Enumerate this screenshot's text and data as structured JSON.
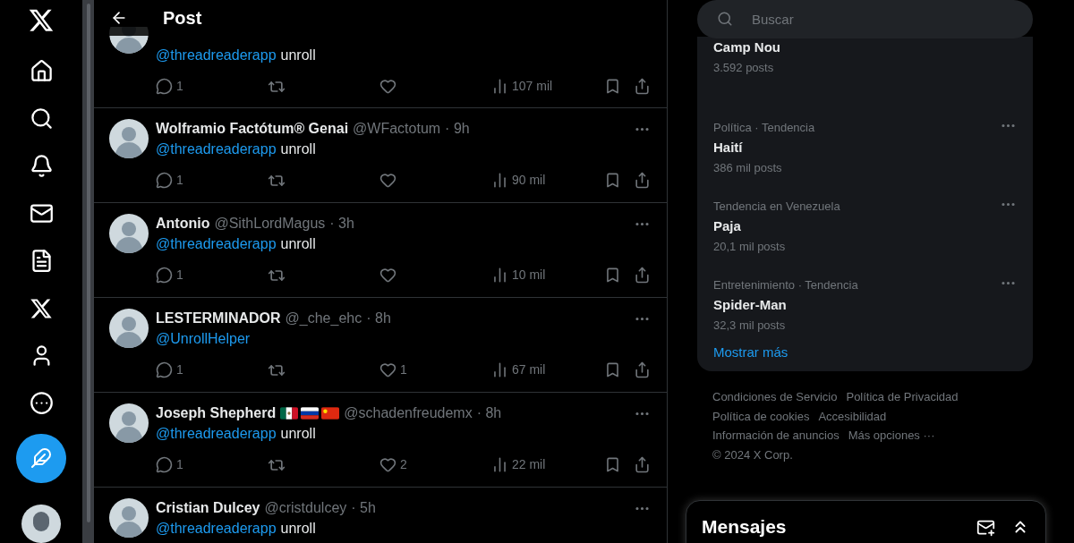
{
  "header": {
    "title": "Post"
  },
  "posts": [
    {
      "mention": "@threadreaderapp",
      "text": "unroll",
      "replies": "1",
      "views": "107 mil"
    },
    {
      "name": "Wolframio Factótum® Genai",
      "handle": "@WFactotum",
      "time": "· 9h",
      "mention": "@threadreaderapp",
      "text": "unroll",
      "replies": "1",
      "views": "90 mil"
    },
    {
      "name": "Antonio",
      "handle": "@SithLordMagus",
      "time": "· 3h",
      "mention": "@threadreaderapp",
      "text": "unroll",
      "replies": "1",
      "views": "10 mil"
    },
    {
      "name": "LESTERMINADOR",
      "handle": "@_che_ehc",
      "time": "· 8h",
      "mention": "@UnrollHelper",
      "replies": "1",
      "likes": "1",
      "views": "67 mil"
    },
    {
      "name": "Joseph Shepherd",
      "flags": [
        {
          "kind": "mexico"
        },
        {
          "kind": "russia"
        },
        {
          "kind": "china"
        }
      ],
      "handle": "@schadenfreudemx",
      "time": "· 8h",
      "mention": "@threadreaderapp",
      "text": "unroll",
      "replies": "1",
      "likes": "2",
      "views": "22 mil"
    },
    {
      "name": "Cristian Dulcey",
      "handle": "@cristdulcey",
      "time": "· 5h",
      "mention": "@threadreaderapp",
      "text": "unroll"
    }
  ],
  "search": {
    "placeholder": "Buscar"
  },
  "trends": [
    {
      "title": "Camp Nou",
      "count": "3.592 posts"
    },
    {
      "category": "Política · Tendencia",
      "title": "Haití",
      "count": "386 mil posts"
    },
    {
      "category": "Tendencia en Venezuela",
      "title": "Paja",
      "count": "20,1 mil posts"
    },
    {
      "category": "Entretenimiento · Tendencia",
      "title": "Spider-Man",
      "count": "32,3 mil posts"
    }
  ],
  "show_more": "Mostrar más",
  "footer_links": [
    "Condiciones de Servicio",
    "Política de Privacidad",
    "Política de cookies",
    "Accesibilidad",
    "Información de anuncios",
    "Más opciones ···"
  ],
  "copyright": "© 2024 X Corp.",
  "messages": {
    "title": "Mensajes"
  }
}
